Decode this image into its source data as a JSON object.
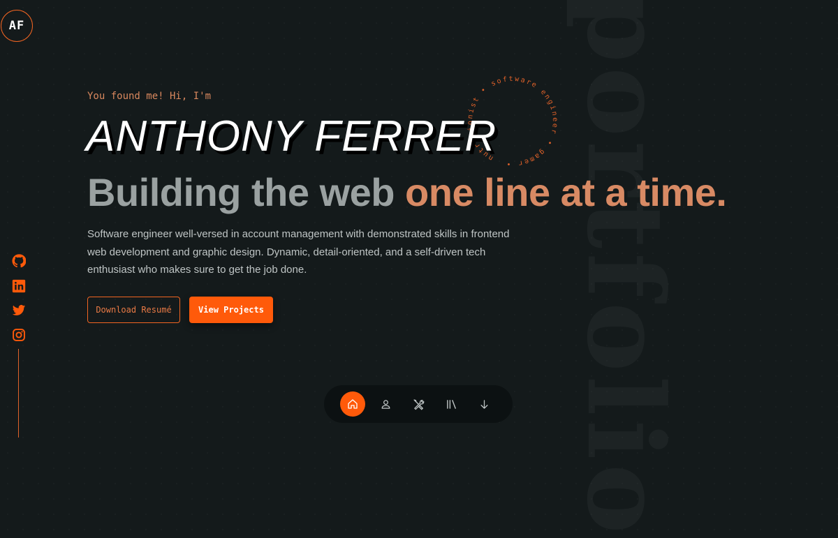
{
  "logo": {
    "text": "AF"
  },
  "hero": {
    "greeting": "You found me! Hi, I'm",
    "name": "ANTHONY FERRER",
    "headline_plain": "Building the web ",
    "headline_accent": "one line at a time.",
    "description": "Software engineer well-versed in account management with demonstrated skills in frontend web development and graphic design. Dynamic, detail-oriented, and a self-driven tech enthusiast who makes sure to get the job done.",
    "ring_text": "nutritionist • software engineer • gamer • "
  },
  "buttons": {
    "download": "Download Resumé",
    "projects": "View Projects"
  },
  "watermark": "portfolio",
  "social": [
    "github-icon",
    "linkedin-icon",
    "twitter-icon",
    "instagram-icon"
  ],
  "dock": [
    "home-icon",
    "user-icon",
    "tools-icon",
    "library-icon",
    "arrow-down-icon"
  ],
  "colors": {
    "accent": "#ff5a0a",
    "background": "#141a1b",
    "headline_accent": "#d88a64"
  }
}
